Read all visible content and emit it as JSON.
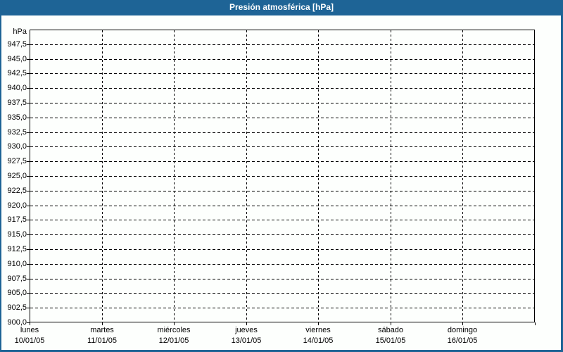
{
  "header": {
    "title": "Presión atmosférica [hPa]"
  },
  "colors": {
    "frame_blue": "#1e6496",
    "title_text": "#ffffff",
    "plot_background": "#fdfffd",
    "grid_line": "#000000",
    "label_text": "#000000"
  },
  "chart_data": {
    "type": "line",
    "title": "Presión atmosférica [hPa]",
    "ylabel": "hPa",
    "ylim": [
      900,
      950
    ],
    "y_tick_step": 2.5,
    "y_tick_labels": [
      "947,5",
      "945,0",
      "942,5",
      "940,0",
      "937,5",
      "935,0",
      "932,5",
      "930,0",
      "927,5",
      "925,0",
      "922,5",
      "920,0",
      "917,5",
      "915,0",
      "912,5",
      "910,0",
      "907,5",
      "905,0",
      "902,5",
      "900,0"
    ],
    "x_ticks": [
      {
        "day": "lunes",
        "date": "10/01/05"
      },
      {
        "day": "martes",
        "date": "11/01/05"
      },
      {
        "day": "miércoles",
        "date": "12/01/05"
      },
      {
        "day": "jueves",
        "date": "13/01/05"
      },
      {
        "day": "viernes",
        "date": "14/01/05"
      },
      {
        "day": "sábado",
        "date": "15/01/05"
      },
      {
        "day": "domingo",
        "date": "16/01/05"
      }
    ],
    "grid": "dashed",
    "legend": "none",
    "series": []
  }
}
